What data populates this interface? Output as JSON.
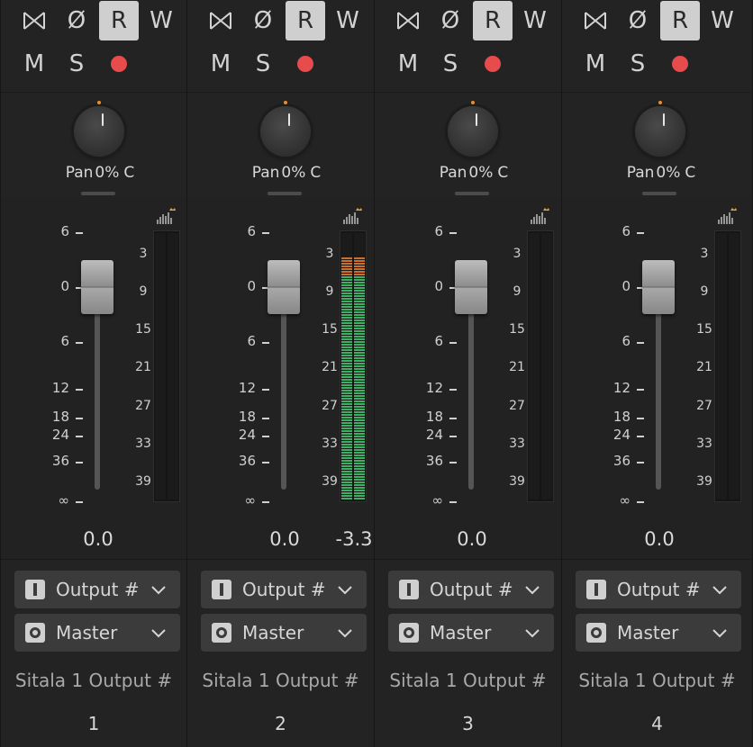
{
  "strips": [
    {
      "buttons": {
        "phase_label": "Ø",
        "read_label": "R",
        "write_label": "W",
        "mute_label": "M",
        "solo_label": "S"
      },
      "pan": {
        "label": "Pan",
        "value": "0%",
        "side": "C"
      },
      "fader_value": "0.0",
      "peak_value": "",
      "meter_level": 0,
      "output": {
        "label": "Output #"
      },
      "send": {
        "label": "Master"
      },
      "name": "Sitala 1 Output #",
      "number": "1"
    },
    {
      "buttons": {
        "phase_label": "Ø",
        "read_label": "R",
        "write_label": "W",
        "mute_label": "M",
        "solo_label": "S"
      },
      "pan": {
        "label": "Pan",
        "value": "0%",
        "side": "C"
      },
      "fader_value": "0.0",
      "peak_value": "-3.3",
      "meter_level": 0.91,
      "output": {
        "label": "Output #"
      },
      "send": {
        "label": "Master"
      },
      "name": "Sitala 1 Output #",
      "number": "2"
    },
    {
      "buttons": {
        "phase_label": "Ø",
        "read_label": "R",
        "write_label": "W",
        "mute_label": "M",
        "solo_label": "S"
      },
      "pan": {
        "label": "Pan",
        "value": "0%",
        "side": "C"
      },
      "fader_value": "0.0",
      "peak_value": "",
      "meter_level": 0,
      "output": {
        "label": "Output #"
      },
      "send": {
        "label": "Master"
      },
      "name": "Sitala 1 Output #",
      "number": "3"
    },
    {
      "buttons": {
        "phase_label": "Ø",
        "read_label": "R",
        "write_label": "W",
        "mute_label": "M",
        "solo_label": "S"
      },
      "pan": {
        "label": "Pan",
        "value": "0%",
        "side": "C"
      },
      "fader_value": "0.0",
      "peak_value": "",
      "meter_level": 0,
      "output": {
        "label": "Output #"
      },
      "send": {
        "label": "Master"
      },
      "name": "Sitala 1 Output #",
      "number": "4"
    }
  ],
  "fader_scale": [
    "6",
    "0",
    "6",
    "12",
    "18",
    "24",
    "36",
    "∞"
  ],
  "meter_scale": [
    "3",
    "9",
    "15",
    "21",
    "27",
    "33",
    "39"
  ],
  "colors": {
    "record": "#e84b4b",
    "meter_green": "#3fae67",
    "meter_orange": "#c8712e",
    "pan_dot": "#f08a24",
    "read_active": "#cfcfcf"
  }
}
